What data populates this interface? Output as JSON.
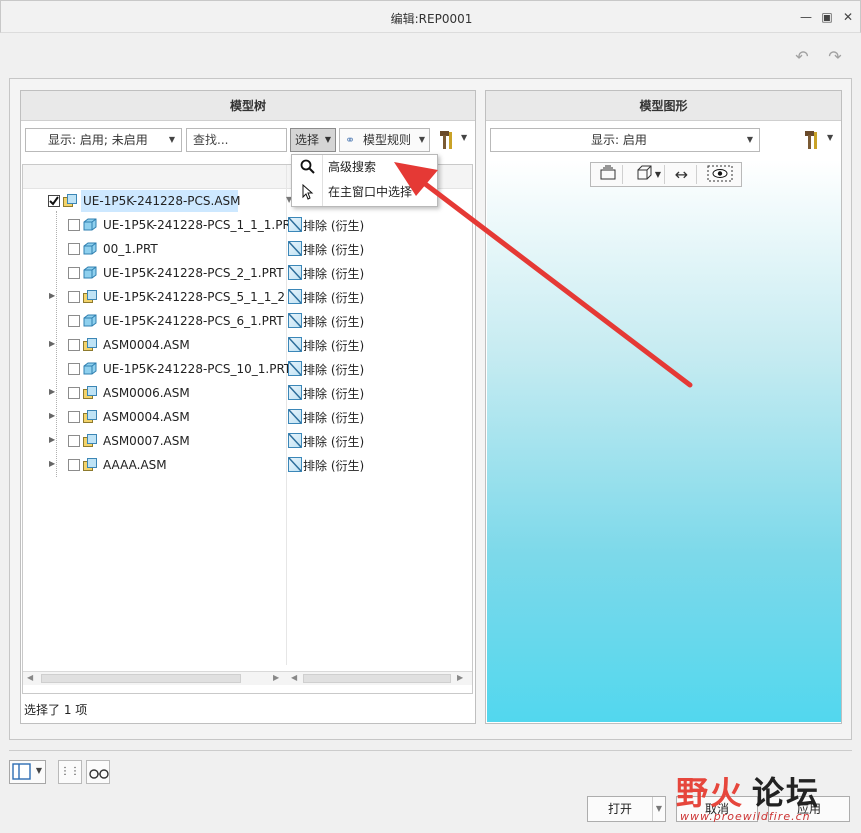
{
  "window": {
    "title": "编辑:REP0001"
  },
  "left_panel": {
    "title": "模型树",
    "display_dropdown": "显示: 启用; 未启用",
    "find_placeholder": "查找...",
    "select_button": "选择",
    "rules_button": "模型规则",
    "status": "选择了 1 项"
  },
  "tree": {
    "root": "UE-1P5K-241228-PCS.ASM",
    "items": [
      {
        "label": "UE-1P5K-241228-PCS_1_1_1.PRT",
        "status": "排除 (衍生)",
        "expandable": false,
        "type": "part"
      },
      {
        "label": "00_1.PRT",
        "status": "排除 (衍生)",
        "expandable": false,
        "type": "part"
      },
      {
        "label": "UE-1P5K-241228-PCS_2_1.PRT",
        "status": "排除 (衍生)",
        "expandable": false,
        "type": "part"
      },
      {
        "label": "UE-1P5K-241228-PCS_5_1_1_2",
        "status": "排除 (衍生)",
        "expandable": true,
        "type": "asm"
      },
      {
        "label": "UE-1P5K-241228-PCS_6_1.PRT",
        "status": "排除 (衍生)",
        "expandable": false,
        "type": "part"
      },
      {
        "label": "ASM0004.ASM",
        "status": "排除 (衍生)",
        "expandable": true,
        "type": "asm"
      },
      {
        "label": "UE-1P5K-241228-PCS_10_1.PRT",
        "status": "排除 (衍生)",
        "expandable": false,
        "type": "part"
      },
      {
        "label": "ASM0006.ASM",
        "status": "排除 (衍生)",
        "expandable": true,
        "type": "asm"
      },
      {
        "label": "ASM0004.ASM",
        "status": "排除 (衍生)",
        "expandable": true,
        "type": "asm"
      },
      {
        "label": "ASM0007.ASM",
        "status": "排除 (衍生)",
        "expandable": true,
        "type": "asm"
      },
      {
        "label": "AAAA.ASM",
        "status": "排除 (衍生)",
        "expandable": true,
        "type": "asm"
      }
    ]
  },
  "select_menu": {
    "items": [
      {
        "label": "高级搜索",
        "icon": "magnifier-icon"
      },
      {
        "label": "在主窗口中选择",
        "icon": "cursor-icon"
      }
    ]
  },
  "right_panel": {
    "title": "模型图形",
    "display_dropdown": "显示: 启用"
  },
  "footer": {
    "open_button": "打开",
    "cancel_button": "取消",
    "apply_button": "应用"
  },
  "watermark": {
    "text_red": "野火",
    "text_black": "论坛",
    "url": "www.proewildfire.cn"
  },
  "colors": {
    "arrow": "#e53935",
    "selection": "#cde8ff",
    "viewport_bottom": "#52d7ee"
  }
}
